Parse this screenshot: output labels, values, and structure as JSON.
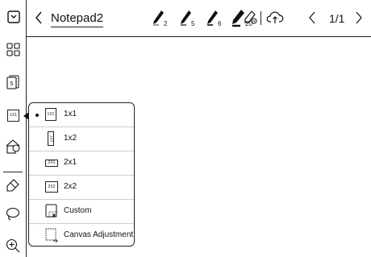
{
  "header": {
    "title": "Notepad2",
    "pen_sizes": [
      "2",
      "5",
      "6",
      "20"
    ],
    "page_indicator": "1/1"
  },
  "sidebar": {
    "active_template_label": "1X1"
  },
  "template_menu": {
    "selected": "1x1",
    "items": [
      {
        "label": "1x1",
        "icon_text": "1X1"
      },
      {
        "label": "1x2",
        "icon_text": "1X2"
      },
      {
        "label": "2x1",
        "icon_text": "2X1"
      },
      {
        "label": "2x2",
        "icon_text": "2X2"
      },
      {
        "label": "Custom",
        "icon_text": ""
      },
      {
        "label": "Canvas Adjustment",
        "icon_text": ""
      }
    ]
  }
}
